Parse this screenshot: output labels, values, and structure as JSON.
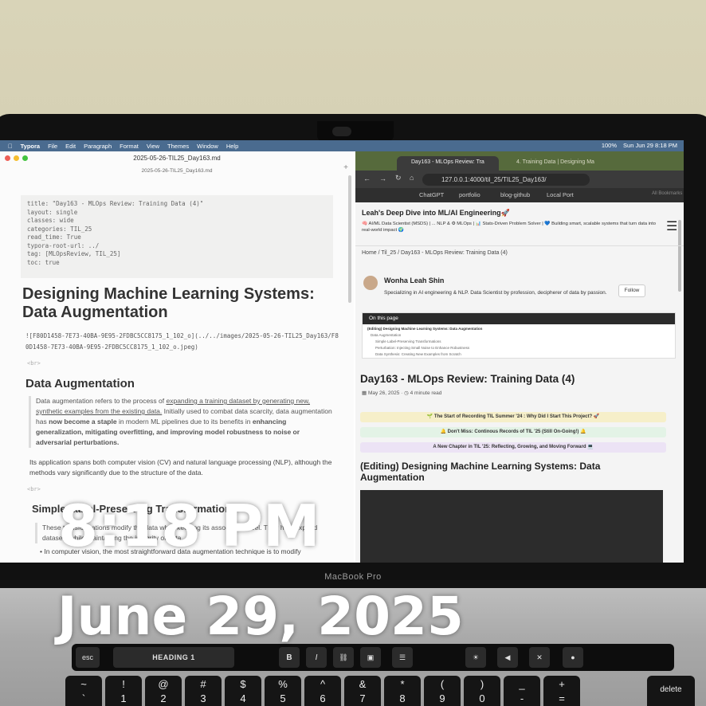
{
  "overlay": {
    "time": "8:18 PM",
    "date": "June 29, 2025"
  },
  "menubar": {
    "apple": "",
    "items": [
      "Typora",
      "File",
      "Edit",
      "Paragraph",
      "Format",
      "View",
      "Themes",
      "Window",
      "Help"
    ],
    "battery": "100%",
    "clock": "Sun Jun 29  8:18 PM"
  },
  "typora": {
    "window_title": "2025-05-26-TIL25_Day163.md",
    "file_name": "2025-05-26-TIL25_Day163.md",
    "front_matter": [
      "title: \"Day163 - MLOps Review: Training Data (4)\"",
      "layout: single",
      "classes: wide",
      "categories: TIL_25",
      "read_time: True",
      "typora-root-url: ../",
      "tag: [MLOpsReview, TIL_25]",
      "toc: true"
    ],
    "h1": "Designing Machine Learning Systems: Data Augmentation",
    "image_ref": "![F80D1458-7E73-40BA-9E95-2FDBC5CC8175_1_102_o](../../images/2025-05-26-TIL25_Day163/F80D1458-7E73-40BA-9E95-2FDBC5CC8175_1_102_o.jpeg)",
    "br": "<br>",
    "h2": "Data Augmentation",
    "quote_pre": "Data augmentation refers to the process of ",
    "quote_link": "expanding a training dataset by generating new, synthetic examples from the existing data.",
    "quote_mid": " Initially used to combat data scarcity, data augmentation has ",
    "quote_bold1": "now become a staple",
    "quote_mid2": " in modern ML pipelines due to its benefits in ",
    "quote_bold2": "enhancing generalization, mitigating overfitting, and improving model robustness to noise or adversarial perturbations.",
    "para2": "Its application spans both computer vision (CV) and natural language processing (NLP), although the methods vary significantly due to the structure of the data.",
    "h3": "Simple Label-Preserving Transformations",
    "quote2": "These transformations modify the data while keeping its associated label. They help expand datasets while maintaining the integrity of data.",
    "bullet": "In computer vision, the most straightforward data augmentation technique is to modify"
  },
  "browser": {
    "tab_active": "Day163 - MLOps Review: Tra",
    "tab_other": "4. Training Data | Designing Ma",
    "url": "127.0.0.1:4000/til_25/TIL25_Day163/",
    "bookmarks": [
      "ChatGPT",
      "portfolio",
      "blog-github",
      "Local Port"
    ],
    "all_bookmarks": "All Bookmarks",
    "site_title": "Leah's Deep Dive into ML/AI Engineering🚀",
    "site_subtitle": "🧠 AI/ML Data Scientist (MSDS) | ... NLP & ⚙ MLOps | 📊 Stats-Driven Problem Solver | 💙 Building smart, scalable systems that turn data into real-world impact 🌍",
    "breadcrumb": "Home / Til_25 / Day163 - MLOps Review: Training Data (4)",
    "author": "Wonha Leah Shin",
    "bio": "Specializing in AI engineering & NLP. Data Scientist by profession, decipherer of data by passion.",
    "follow": "Follow",
    "toc_title": "On this page",
    "toc_items": [
      "(Editing) Designing Machine Learning Systems: Data Augmentation",
      "Data Augmentation",
      "Simple Label-Preserving Transformations",
      "Perturbation: Injecting Small Noise to Enhance Robustness",
      "Data Synthesis: Creating New Examples from Scratch"
    ],
    "post_title": "Day163 - MLOps Review: Training Data (4)",
    "post_date": "May 26, 2025",
    "read_time": "4 minute read",
    "banners": [
      {
        "text": "🌱 The Start of Recording TIL Summer '24 : Why Did I Start This Project? 🚀",
        "color": "#f6efc9"
      },
      {
        "text": "🔔 Don't Miss: Continous Records of TIL '25 (Still On-Going!) 🔔",
        "color": "#e3f3e6"
      },
      {
        "text": "A New Chapter in TIL '25: Reflecting, Growing, and Moving Forward 💻",
        "color": "#ece3f5"
      }
    ],
    "section_title": "(Editing) Designing Machine Learning Systems: Data Augmentation"
  },
  "laptop": {
    "model": "MacBook Pro",
    "touchbar": {
      "esc": "esc",
      "style": "HEADING 1",
      "bold": "B",
      "italic": "I"
    },
    "keys": [
      {
        "top": "~",
        "bottom": "`"
      },
      {
        "top": "!",
        "bottom": "1"
      },
      {
        "top": "@",
        "bottom": "2"
      },
      {
        "top": "#",
        "bottom": "3"
      },
      {
        "top": "$",
        "bottom": "4"
      },
      {
        "top": "%",
        "bottom": "5"
      },
      {
        "top": "^",
        "bottom": "6"
      },
      {
        "top": "&",
        "bottom": "7"
      },
      {
        "top": "*",
        "bottom": "8"
      },
      {
        "top": "(",
        "bottom": "9"
      },
      {
        "top": ")",
        "bottom": "0"
      },
      {
        "top": "_",
        "bottom": "-"
      },
      {
        "top": "+",
        "bottom": "="
      }
    ],
    "delete": "delete"
  }
}
